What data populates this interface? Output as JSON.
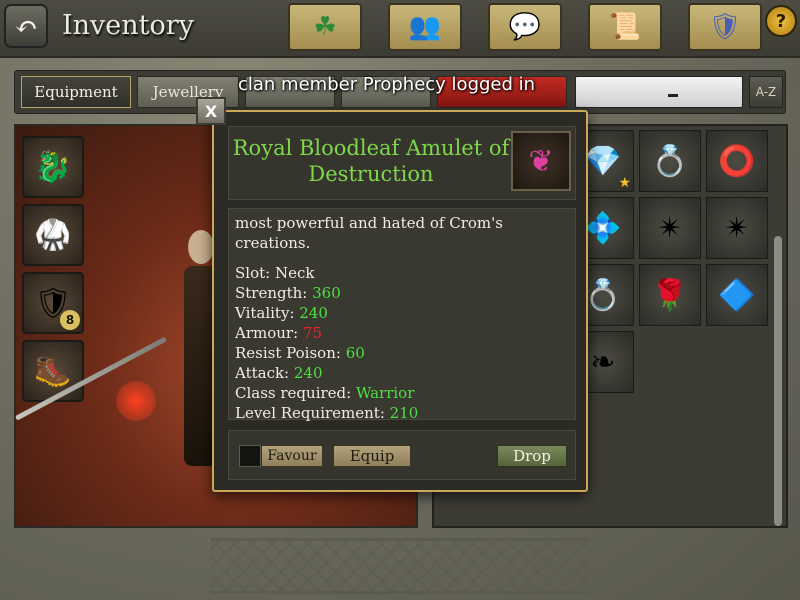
{
  "header": {
    "back_icon": "↶",
    "title": "Inventory",
    "nav": [
      {
        "icon": "triskelion-icon",
        "glyph": "☘"
      },
      {
        "icon": "clan-members-icon",
        "glyph": "👥"
      },
      {
        "icon": "chat-bubble-icon",
        "glyph": "💬"
      },
      {
        "icon": "quest-scroll-icon",
        "glyph": "📜"
      },
      {
        "icon": "shield-crest-icon",
        "glyph": "🛡"
      }
    ],
    "help_label": "?"
  },
  "tabs": {
    "equipment": "Equipment",
    "jewellery": "Jewellery",
    "tab3": "",
    "tab4": "",
    "tab5": "",
    "sort_label": "A-Z",
    "search_value": ""
  },
  "notification": "clan member Prophecy logged in",
  "character": {
    "slots": [
      {
        "icon": "dragon-helm-icon",
        "glyph": "🐉",
        "count": ""
      },
      {
        "icon": "chest-armor-icon",
        "glyph": "🥋",
        "count": ""
      },
      {
        "icon": "gold-shield-icon",
        "glyph": "🛡",
        "count": "8"
      },
      {
        "icon": "boots-icon",
        "glyph": "🥾",
        "count": ""
      }
    ]
  },
  "inventory": {
    "items": [
      {
        "icon": "ring-icon",
        "glyph": "💍",
        "star": true,
        "count": ""
      },
      {
        "icon": "amulet-icon",
        "glyph": "📿",
        "star": true,
        "count": ""
      },
      {
        "icon": "sapphire-ring-icon",
        "glyph": "💎",
        "star": true,
        "count": ""
      },
      {
        "icon": "ring-icon",
        "glyph": "💍",
        "star": false,
        "count": ""
      },
      {
        "icon": "ruby-ring-icon",
        "glyph": "⭕",
        "star": false,
        "count": ""
      },
      {
        "icon": "silver-ring-icon",
        "glyph": "💍",
        "star": false,
        "count": ""
      },
      {
        "icon": "ring-icon",
        "glyph": "💍",
        "star": false,
        "count": "2"
      },
      {
        "icon": "blue-ring-icon",
        "glyph": "💠",
        "star": false,
        "count": ""
      },
      {
        "icon": "spiked-ring-icon",
        "glyph": "✴",
        "star": false,
        "count": ""
      },
      {
        "icon": "spiked-ring-icon",
        "glyph": "✴",
        "star": false,
        "count": ""
      },
      {
        "icon": "eye-ring-icon",
        "glyph": "👁",
        "star": false,
        "count": ""
      },
      {
        "icon": "amulet-icon",
        "glyph": "❦",
        "star": false,
        "count": ""
      },
      {
        "icon": "gold-ring-icon",
        "glyph": "💍",
        "star": false,
        "count": ""
      },
      {
        "icon": "flower-ring-icon",
        "glyph": "🌹",
        "star": false,
        "count": ""
      },
      {
        "icon": "blue-amulet-icon",
        "glyph": "🔷",
        "star": false,
        "count": ""
      },
      {
        "icon": "amulet-icon",
        "glyph": "❦",
        "star": false,
        "count": ""
      },
      {
        "icon": "gold-ring-icon",
        "glyph": "💍",
        "star": false,
        "count": ""
      },
      {
        "icon": "green-amulet-icon",
        "glyph": "❧",
        "star": false,
        "count": ""
      }
    ]
  },
  "tooltip": {
    "close_label": "X",
    "item_name": "Royal Bloodleaf Amulet of Destruction",
    "item_icon": "bloodleaf-amulet-icon",
    "description": "most powerful and hated of Crom's creations.",
    "stats": [
      {
        "label": "Slot: ",
        "value": "Neck",
        "color": "plain"
      },
      {
        "label": "Strength: ",
        "value": "360",
        "color": "green"
      },
      {
        "label": "Vitality: ",
        "value": "240",
        "color": "green"
      },
      {
        "label": "Armour: ",
        "value": "75",
        "color": "red"
      },
      {
        "label": "Resist Poison: ",
        "value": "60",
        "color": "green"
      },
      {
        "label": "Attack: ",
        "value": "240",
        "color": "green"
      },
      {
        "label": "Class required: ",
        "value": "Warrior",
        "color": "green"
      },
      {
        "label": "Level Requirement: ",
        "value": " 210",
        "color": "green"
      }
    ],
    "favour_label": "Favour",
    "equip_label": "Equip",
    "drop_label": "Drop"
  },
  "colors": {
    "stat_green": "#4ee040",
    "stat_red": "#e02a2a",
    "item_name": "#7fd84a"
  }
}
